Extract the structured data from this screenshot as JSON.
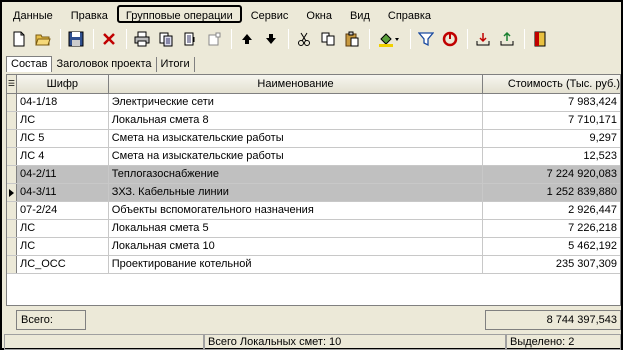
{
  "menu": [
    "Данные",
    "Правка",
    "Групповые операции",
    "Сервис",
    "Окна",
    "Вид",
    "Справка"
  ],
  "toolbar": [
    "new-doc-icon",
    "open-folder-icon",
    "save-icon",
    "delete-icon",
    "print-icon",
    "copy-doc-icon",
    "paste-doc-icon",
    "blank-icon",
    "arrow-up-icon",
    "arrow-down-icon",
    "cut-icon",
    "copy-icon",
    "paste-icon",
    "fill-color-icon",
    "filter-icon",
    "refresh-icon",
    "import-icon",
    "export-icon",
    "exit-icon"
  ],
  "tabs": [
    "Состав",
    "Заголовок проекта",
    "Итоги"
  ],
  "columns": {
    "code": "Шифр",
    "name": "Наименование",
    "cost": "Стоимость (Тыс. руб.)"
  },
  "rows": [
    {
      "code": "04-1/18",
      "name": "Электрические сети",
      "cost": "7 983,424",
      "selected": false,
      "current": false
    },
    {
      "code": "ЛС",
      "name": "Локальная смета 8",
      "cost": "7 710,171",
      "selected": false,
      "current": false
    },
    {
      "code": "ЛС 5",
      "name": "Смета на изыскательские работы",
      "cost": "9,297",
      "selected": false,
      "current": false
    },
    {
      "code": "ЛС 4",
      "name": "Смета на изыскательские работы",
      "cost": "12,523",
      "selected": false,
      "current": false
    },
    {
      "code": "04-2/11",
      "name": "Теплогазоснабжение",
      "cost": "7 224 920,083",
      "selected": true,
      "current": false
    },
    {
      "code": "04-3/11",
      "name": "ЗХЗ. Кабельные линии",
      "cost": "1 252 839,880",
      "selected": true,
      "current": true
    },
    {
      "code": "07-2/24",
      "name": "Объекты вспомогательного назначения",
      "cost": "2 926,447",
      "selected": false,
      "current": false
    },
    {
      "code": "ЛС",
      "name": "Локальная смета 5",
      "cost": "7 226,218",
      "selected": false,
      "current": false
    },
    {
      "code": "ЛС",
      "name": "Локальная смета 10",
      "cost": "5 462,192",
      "selected": false,
      "current": false
    },
    {
      "code": "ЛС_ОСС",
      "name": "Проектирование котельной",
      "cost": "235 307,309",
      "selected": false,
      "current": false
    }
  ],
  "totals": {
    "label": "Всего:",
    "value": "8 744 397,543"
  },
  "status": {
    "count": "Всего Локальных смет: 10",
    "selected": "Выделено: 2"
  }
}
